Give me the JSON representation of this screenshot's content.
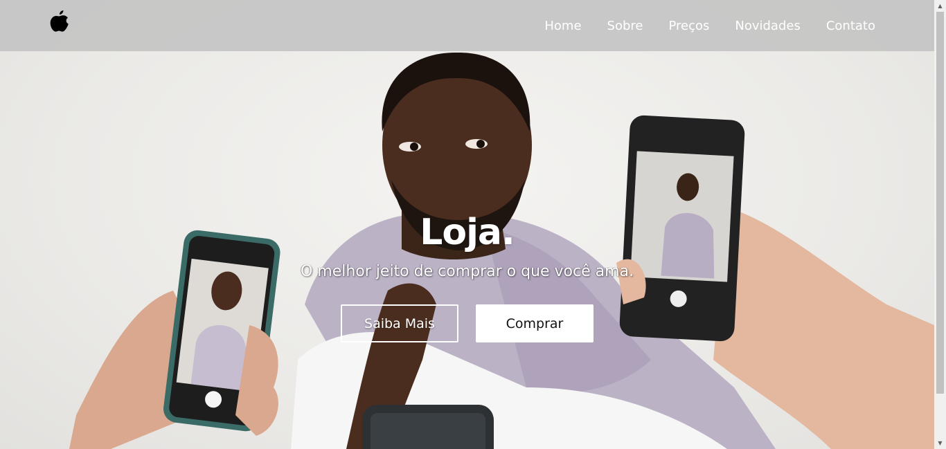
{
  "header": {
    "logo_icon": "apple-logo-icon",
    "nav": [
      {
        "label": "Home"
      },
      {
        "label": "Sobre"
      },
      {
        "label": "Preços"
      },
      {
        "label": "Novidades"
      },
      {
        "label": "Contato"
      }
    ]
  },
  "hero": {
    "title": "Loja.",
    "subtitle": "O melhor jeito de comprar o que você ama.",
    "primary_button": "Saiba Mais",
    "secondary_button": "Comprar"
  },
  "colors": {
    "header_bg": "#c4c4c4",
    "text_on_dark": "#ffffff",
    "button_solid_bg": "#ffffff",
    "button_solid_text": "#111111"
  }
}
